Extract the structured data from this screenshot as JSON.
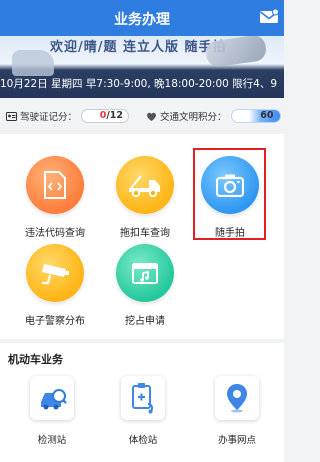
{
  "header": {
    "title": "业务办理"
  },
  "banner": {
    "faded_text": "欢迎/晴/题 连立人版  随手拍",
    "scroll_text": "10月22日 星期四 早7:30-9:00, 晚18:00-20:00 限行4、9"
  },
  "scores": {
    "license": {
      "label": "驾驶证记分：",
      "value": "0",
      "max": "/12"
    },
    "civility": {
      "label": "交通文明积分：",
      "value": "60"
    }
  },
  "services": [
    {
      "label": "违法代码查询",
      "icon": "code-query-icon"
    },
    {
      "label": "拖扣车查询",
      "icon": "tow-truck-icon"
    },
    {
      "label": "随手拍",
      "icon": "camera-icon"
    },
    {
      "label": "电子警察分布",
      "icon": "traffic-camera-icon"
    },
    {
      "label": "挖占申请",
      "icon": "film-clapper-icon"
    }
  ],
  "vehicle_section": {
    "title": "机动车业务",
    "items": [
      {
        "label": "检测站",
        "icon": "inspection-station-icon"
      },
      {
        "label": "体检站",
        "icon": "medical-check-icon"
      },
      {
        "label": "办事网点",
        "icon": "location-pin-icon"
      }
    ]
  },
  "colors": {
    "header_bg": "#2f7de1",
    "highlight_border": "#e32020",
    "license_value": "#e23b3b"
  }
}
